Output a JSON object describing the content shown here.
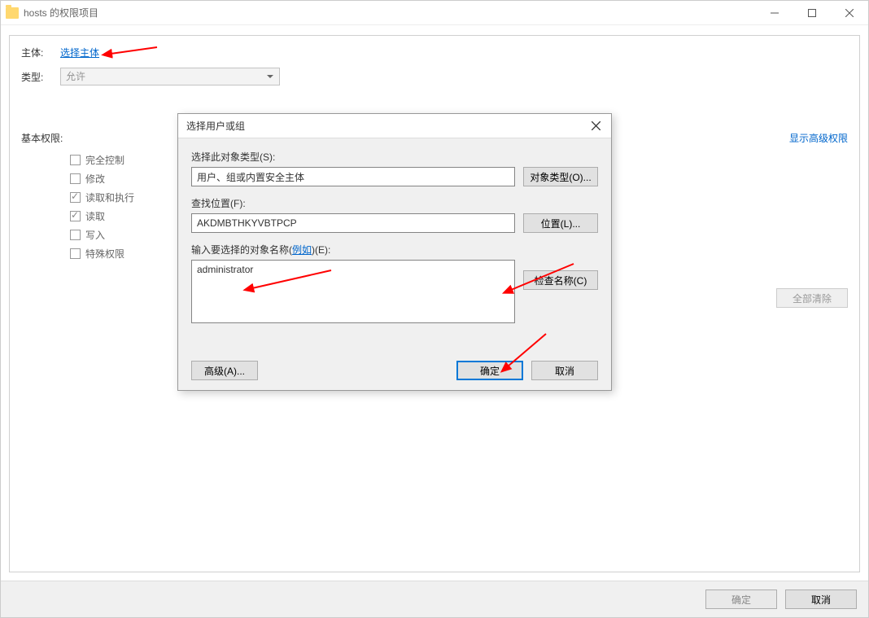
{
  "main_window": {
    "title": "hosts 的权限项目"
  },
  "form": {
    "principal_label": "主体:",
    "principal_link": "选择主体",
    "type_label": "类型:",
    "type_value": "允许"
  },
  "permissions": {
    "section_title": "基本权限:",
    "advanced_link": "显示高级权限",
    "items": [
      {
        "label": "完全控制",
        "checked": false
      },
      {
        "label": "修改",
        "checked": false
      },
      {
        "label": "读取和执行",
        "checked": true
      },
      {
        "label": "读取",
        "checked": true
      },
      {
        "label": "写入",
        "checked": false
      },
      {
        "label": "特殊权限",
        "checked": false
      }
    ],
    "clear_all": "全部清除"
  },
  "main_footer": {
    "ok": "确定",
    "cancel": "取消"
  },
  "dialog": {
    "title": "选择用户或组",
    "object_type_label": "选择此对象类型(S):",
    "object_type_value": "用户、组或内置安全主体",
    "object_type_btn": "对象类型(O)...",
    "location_label": "查找位置(F):",
    "location_value": "AKDMBTHKYVBTPCP",
    "location_btn": "位置(L)...",
    "name_label_pre": "输入要选择的对象名称(",
    "name_label_link": "例如",
    "name_label_post": ")(E):",
    "name_value": "administrator",
    "check_names_btn": "检查名称(C)",
    "advanced_btn": "高级(A)...",
    "ok": "确定",
    "cancel": "取消"
  }
}
